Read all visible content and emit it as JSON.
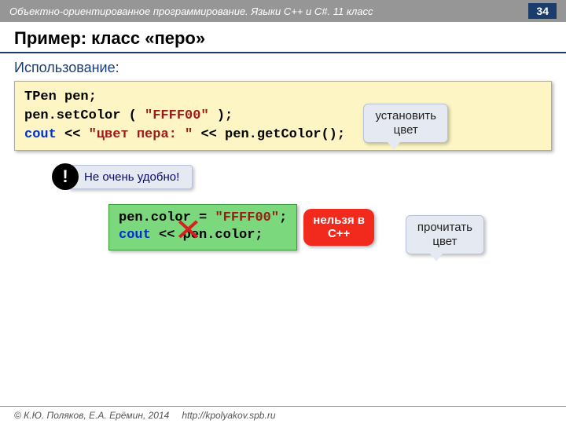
{
  "header": {
    "course": "Объектно-ориентированное программирование. Языки C++ и C#. 11 класс",
    "page": "34"
  },
  "title": "Пример: класс «перо»",
  "usage_label": "Использование:",
  "callouts": {
    "set_color": "установить\nцвет",
    "read_color": "прочитать\nцвет"
  },
  "code_yellow": {
    "l1_a": "TPen pen;",
    "l2_a": "pen.setColor ( ",
    "l2_b": "\"FFFF00\"",
    "l2_c": " );",
    "l3_a": "cout",
    "l3_b": " << ",
    "l3_c": "\"цвет пера: \"",
    "l3_d": " << pen.getColor();"
  },
  "warning": {
    "mark": "!",
    "text": "Не очень удобно!"
  },
  "code_green": {
    "l1_a": "pen.color",
    "l1_b": " = ",
    "l1_c": "\"FFFF00\"",
    "l1_d": ";",
    "l2_a": "cout",
    "l2_b": " << pen.color;"
  },
  "red_badge": "нельзя в\nC++",
  "red_x": "✕",
  "footer": {
    "copyright": "© К.Ю. Поляков, Е.А. Ерёмин, 2014",
    "url": "http://kpolyakov.spb.ru"
  }
}
